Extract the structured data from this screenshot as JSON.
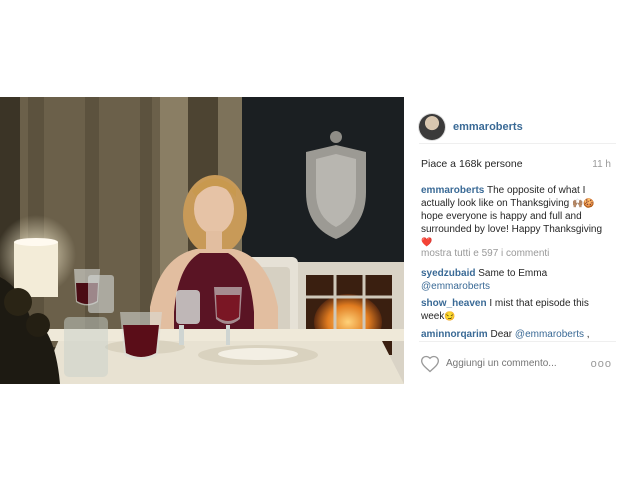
{
  "post": {
    "username": "emmaroberts",
    "likes": "Piace a 168k persone",
    "time": "11 h",
    "caption": {
      "author": "emmaroberts",
      "text_1": " The opposite of what I actually look like on Thanksgiving ",
      "emoji_1": "🙌🏽🍪",
      "text_2": " hope everyone is happy and full and surrounded by love! Happy Thanksgiving ",
      "emoji_2": "❤️"
    },
    "view_all": "mostra tutti e 597 i commenti",
    "comments": [
      {
        "user": "syedzubaid",
        "text": " Same to Emma ",
        "mention": "@emmaroberts"
      },
      {
        "user": "show_heaven",
        "text": " I mist that episode this week",
        "emoji": "😏"
      },
      {
        "user": "aminnorqarim",
        "text": " Dear ",
        "mention": "@emmaroberts",
        "suffix": " ,"
      }
    ],
    "add_comment_placeholder": "Aggiungi un commento...",
    "more_label": "ooo"
  }
}
